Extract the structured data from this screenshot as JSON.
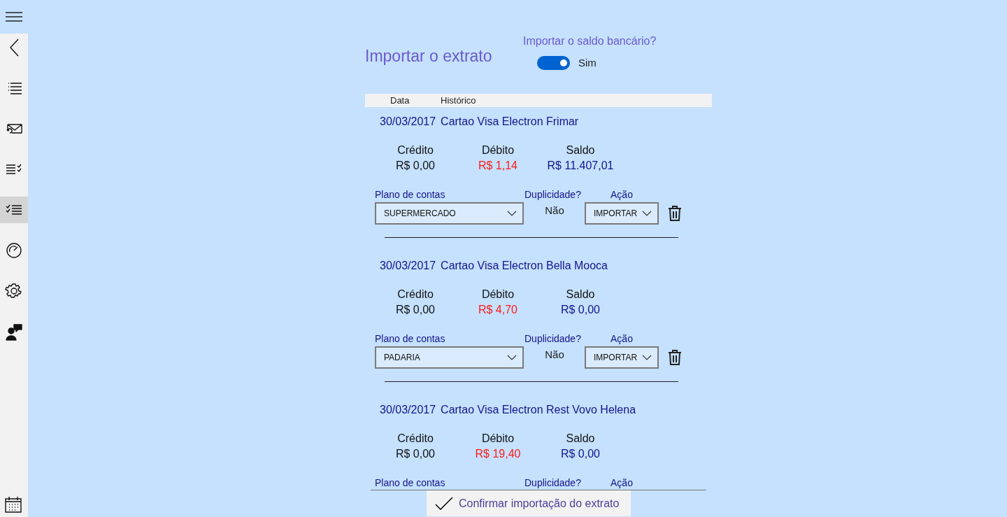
{
  "sidebar": {
    "items": [
      {
        "selected": false
      },
      {
        "selected": false
      },
      {
        "selected": false
      },
      {
        "selected": false
      },
      {
        "selected": true
      },
      {
        "selected": false
      },
      {
        "selected": false
      },
      {
        "selected": false
      }
    ]
  },
  "title": "Importar o extrato",
  "balance_import": {
    "label": "Importar o saldo bancário?",
    "on": true,
    "state_text": "Sim"
  },
  "table": {
    "columns": [
      "Data",
      "Histórico"
    ],
    "rows": [
      {
        "date": "30/03/2017",
        "description": "Cartao Visa Electron Frimar",
        "credit_label": "Crédito",
        "credit": "R$ 0,00",
        "debit_label": "Débito",
        "debit": "R$ 1,14",
        "balance_label": "Saldo",
        "balance": "R$ 11.407,01",
        "account_label": "Plano de contas",
        "account": "SUPERMERCADO",
        "duplicate_label": "Duplicidade?",
        "duplicate": "Não",
        "action_label": "Ação",
        "action": "IMPORTAR"
      },
      {
        "date": "30/03/2017",
        "description": "Cartao Visa Electron Bella Mooca",
        "credit_label": "Crédito",
        "credit": "R$ 0,00",
        "debit_label": "Débito",
        "debit": "R$ 4,70",
        "balance_label": "Saldo",
        "balance": "R$ 0,00",
        "account_label": "Plano de contas",
        "account": "PADARIA",
        "duplicate_label": "Duplicidade?",
        "duplicate": "Não",
        "action_label": "Ação",
        "action": "IMPORTAR"
      },
      {
        "date": "30/03/2017",
        "description": "Cartao Visa Electron Rest Vovo Helena",
        "credit_label": "Crédito",
        "credit": "R$ 0,00",
        "debit_label": "Débito",
        "debit": "R$ 19,40",
        "balance_label": "Saldo",
        "balance": "R$ 0,00",
        "account_label": "Plano de contas",
        "duplicate_label": "Duplicidade?",
        "action_label": "Ação"
      }
    ]
  },
  "confirm_button": "Confirmar importação do extrato"
}
